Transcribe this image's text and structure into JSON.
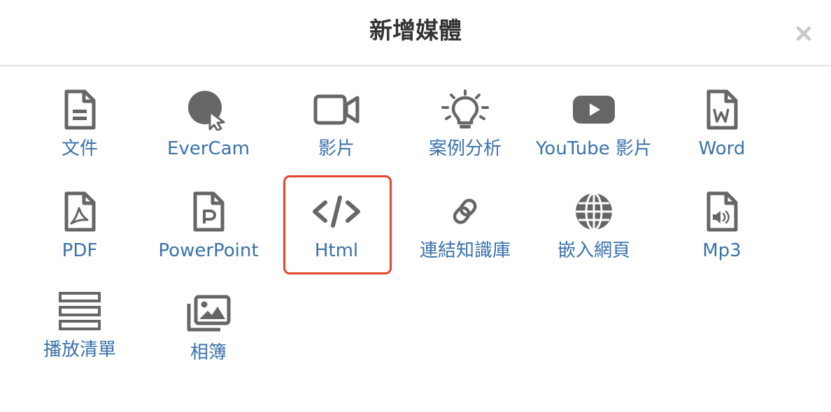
{
  "dialog": {
    "title": "新增媒體",
    "close_label": "×"
  },
  "colors": {
    "icon": "#666666",
    "label": "#3a72ab",
    "highlight": "#e5432d"
  },
  "media_types": [
    {
      "label": "文件",
      "icon": "document-icon"
    },
    {
      "label": "EverCam",
      "icon": "evercam-icon"
    },
    {
      "label": "影片",
      "icon": "video-camera-icon"
    },
    {
      "label": "案例分析",
      "icon": "lightbulb-icon"
    },
    {
      "label": "YouTube 影片",
      "icon": "youtube-icon"
    },
    {
      "label": "Word",
      "icon": "word-file-icon"
    },
    {
      "label": "PDF",
      "icon": "pdf-file-icon"
    },
    {
      "label": "PowerPoint",
      "icon": "powerpoint-file-icon"
    },
    {
      "label": "Html",
      "icon": "code-icon",
      "highlighted": true
    },
    {
      "label": "連結知識庫",
      "icon": "link-icon"
    },
    {
      "label": "嵌入網頁",
      "icon": "globe-icon"
    },
    {
      "label": "Mp3",
      "icon": "audio-file-icon"
    },
    {
      "label": "播放清單",
      "icon": "playlist-icon"
    },
    {
      "label": "相簿",
      "icon": "photo-album-icon"
    }
  ]
}
